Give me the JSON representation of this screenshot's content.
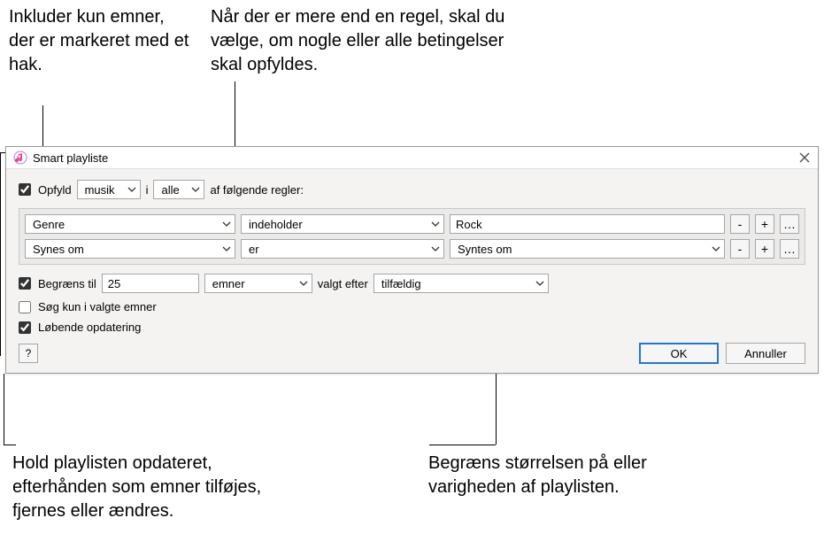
{
  "callouts": {
    "top_left": "Inkluder kun emner, der er markeret med et hak.",
    "top_right": "Når der er mere end en regel, skal du vælge, om nogle eller alle betingelser skal opfyldes.",
    "bottom_left": "Hold playlisten opdateret, efterhånden som emner tilføjes, fjernes eller ændres.",
    "bottom_right": "Begræns størrelsen på eller varigheden af playlisten."
  },
  "dialog": {
    "title": "Smart playliste",
    "match": {
      "checkbox_label": "Opfyld",
      "checked": true,
      "media_type": "musik",
      "connector": "i",
      "match_mode": "alle",
      "suffix": "af følgende regler:"
    },
    "rules": [
      {
        "field": "Genre",
        "operator": "indeholder",
        "value_type": "text",
        "value": "Rock"
      },
      {
        "field": "Synes om",
        "operator": "er",
        "value_type": "select",
        "value": "Syntes om"
      }
    ],
    "limit": {
      "checkbox_label": "Begræns til",
      "checked": true,
      "amount": "25",
      "unit": "emner",
      "selected_by_label": "valgt efter",
      "order": "tilfældig"
    },
    "only_checked": {
      "label": "Søg kun i valgte emner",
      "checked": false
    },
    "live_update": {
      "label": "Løbende opdatering",
      "checked": true
    },
    "buttons": {
      "help": "?",
      "ok": "OK",
      "cancel": "Annuller",
      "minus": "-",
      "plus": "+",
      "more": "…"
    }
  }
}
